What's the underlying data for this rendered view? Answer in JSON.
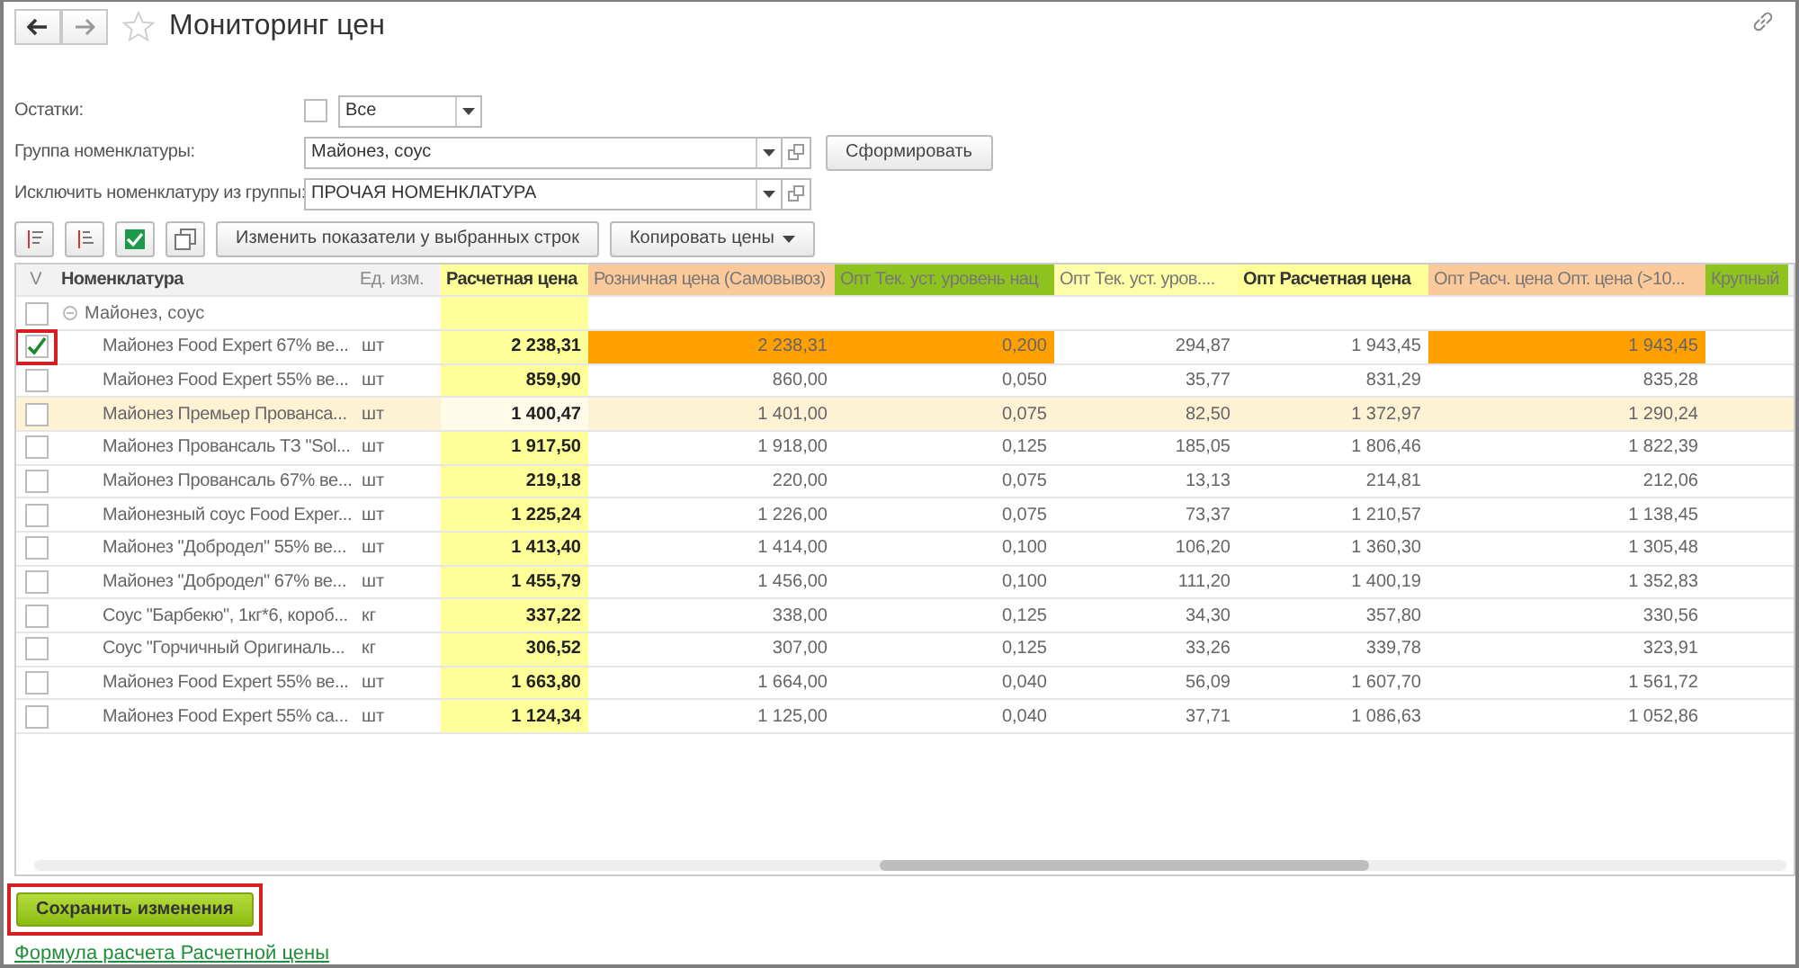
{
  "window": {
    "title": "Мониторинг цен"
  },
  "filters": [
    {
      "label": "Остатки:",
      "kind": "checkcombo",
      "checked": false,
      "value": "Все"
    },
    {
      "label": "Группа номенклатуры:",
      "kind": "select",
      "value": "Майонез, соус",
      "button": "Сформировать"
    },
    {
      "label": "Исключить номенклатуру из группы:",
      "kind": "select",
      "value": "ПРОЧАЯ НОМЕНКЛАТУРА"
    }
  ],
  "toolbar": {
    "buttons": [
      "Изменить показатели у выбранных строк"
    ],
    "menu": "Копировать цены"
  },
  "table": {
    "check_header": "V",
    "name_header": "Номенклатура",
    "unit_header": "Ед. изм.",
    "columns": [
      {
        "title": "Расчетная цена",
        "color": "#ffff99",
        "bold": true
      },
      {
        "title": "Розничная цена (Самовывоз)",
        "color": "#fcc99b",
        "bold": false
      },
      {
        "title": "Опт Тек. уст. уровень нац",
        "color": "#8dc21f",
        "bold": false
      },
      {
        "title": "Опт Тек. уст. уров....",
        "color": "#ffffaa",
        "bold": false
      },
      {
        "title": "Опт Расчетная цена",
        "color": "#ffff99",
        "bold": true
      },
      {
        "title": "Опт Расч. цена Опт. цена (>10...",
        "color": "#fcc99b",
        "bold": false
      },
      {
        "title": "Крупный",
        "color": "#8dc21f",
        "bold": false
      }
    ],
    "group": {
      "name": "Майонез, соус",
      "checked": false,
      "expanded": true
    },
    "rows": [
      {
        "name": "Майонез Food Expert 67% ве...",
        "unit": "шт",
        "cells": [
          {
            "text": "2 238,31",
            "alert": false
          },
          {
            "text": "2 238,31",
            "alert": true
          },
          {
            "text": "0,200",
            "alert": true
          },
          {
            "text": "294,87",
            "alert": false
          },
          {
            "text": "1 943,45",
            "alert": false
          },
          {
            "text": "1 943,45",
            "alert": true
          }
        ],
        "checked": true,
        "annotated": true,
        "selected": false
      },
      {
        "name": "Майонез Food Expert 55% ве...",
        "unit": "шт",
        "cells": [
          {
            "text": "859,90",
            "alert": false
          },
          {
            "text": "860,00",
            "alert": false
          },
          {
            "text": "0,050",
            "alert": false
          },
          {
            "text": "35,77",
            "alert": false
          },
          {
            "text": "831,29",
            "alert": false
          },
          {
            "text": "835,28",
            "alert": false
          }
        ],
        "checked": false,
        "annotated": false,
        "selected": false
      },
      {
        "name": "Майонез Премьер  Прованса...",
        "unit": "шт",
        "cells": [
          {
            "text": "1 400,47",
            "alert": false
          },
          {
            "text": "1 401,00",
            "alert": false
          },
          {
            "text": "0,075",
            "alert": false
          },
          {
            "text": "82,50",
            "alert": false
          },
          {
            "text": "1 372,97",
            "alert": false
          },
          {
            "text": "1 290,24",
            "alert": false
          }
        ],
        "checked": false,
        "annotated": false,
        "selected": true
      },
      {
        "name": "Майонез Провансаль ТЗ \"Sol...",
        "unit": "шт",
        "cells": [
          {
            "text": "1 917,50",
            "alert": false
          },
          {
            "text": "1 918,00",
            "alert": false
          },
          {
            "text": "0,125",
            "alert": false
          },
          {
            "text": "185,05",
            "alert": false
          },
          {
            "text": "1 806,46",
            "alert": false
          },
          {
            "text": "1 822,39",
            "alert": false
          }
        ],
        "checked": false,
        "annotated": false,
        "selected": false
      },
      {
        "name": "Майонез Провансаль 67% ве...",
        "unit": "шт",
        "cells": [
          {
            "text": "219,18",
            "alert": false
          },
          {
            "text": "220,00",
            "alert": false
          },
          {
            "text": "0,075",
            "alert": false
          },
          {
            "text": "13,13",
            "alert": false
          },
          {
            "text": "214,81",
            "alert": false
          },
          {
            "text": "212,06",
            "alert": false
          }
        ],
        "checked": false,
        "annotated": false,
        "selected": false
      },
      {
        "name": "Майонезный соус Food Exper...",
        "unit": "шт",
        "cells": [
          {
            "text": "1 225,24",
            "alert": false
          },
          {
            "text": "1 226,00",
            "alert": false
          },
          {
            "text": "0,075",
            "alert": false
          },
          {
            "text": "73,37",
            "alert": false
          },
          {
            "text": "1 210,57",
            "alert": false
          },
          {
            "text": "1 138,45",
            "alert": false
          }
        ],
        "checked": false,
        "annotated": false,
        "selected": false
      },
      {
        "name": "Майонез \"Добродел\" 55% ве...",
        "unit": "шт",
        "cells": [
          {
            "text": "1 413,40",
            "alert": false
          },
          {
            "text": "1 414,00",
            "alert": false
          },
          {
            "text": "0,100",
            "alert": false
          },
          {
            "text": "106,20",
            "alert": false
          },
          {
            "text": "1 360,30",
            "alert": false
          },
          {
            "text": "1 305,48",
            "alert": false
          }
        ],
        "checked": false,
        "annotated": false,
        "selected": false
      },
      {
        "name": "Майонез \"Добродел\" 67% ве...",
        "unit": "шт",
        "cells": [
          {
            "text": "1 455,79",
            "alert": false
          },
          {
            "text": "1 456,00",
            "alert": false
          },
          {
            "text": "0,100",
            "alert": false
          },
          {
            "text": "111,20",
            "alert": false
          },
          {
            "text": "1 400,19",
            "alert": false
          },
          {
            "text": "1 352,83",
            "alert": false
          }
        ],
        "checked": false,
        "annotated": false,
        "selected": false
      },
      {
        "name": "Соус \"Барбекю\", 1кг*6, короб...",
        "unit": "кг",
        "cells": [
          {
            "text": "337,22",
            "alert": false
          },
          {
            "text": "338,00",
            "alert": false
          },
          {
            "text": "0,125",
            "alert": false
          },
          {
            "text": "34,30",
            "alert": false
          },
          {
            "text": "357,80",
            "alert": false
          },
          {
            "text": "330,56",
            "alert": false
          }
        ],
        "checked": false,
        "annotated": false,
        "selected": false
      },
      {
        "name": "Соус \"Горчичный Оригиналь...",
        "unit": "кг",
        "cells": [
          {
            "text": "306,52",
            "alert": false
          },
          {
            "text": "307,00",
            "alert": false
          },
          {
            "text": "0,125",
            "alert": false
          },
          {
            "text": "33,26",
            "alert": false
          },
          {
            "text": "339,78",
            "alert": false
          },
          {
            "text": "323,91",
            "alert": false
          }
        ],
        "checked": false,
        "annotated": false,
        "selected": false
      },
      {
        "name": "Майонез Food Expert 55% ве...",
        "unit": "шт",
        "cells": [
          {
            "text": "1 663,80",
            "alert": false
          },
          {
            "text": "1 664,00",
            "alert": false
          },
          {
            "text": "0,040",
            "alert": false
          },
          {
            "text": "56,09",
            "alert": false
          },
          {
            "text": "1 607,70",
            "alert": false
          },
          {
            "text": "1 561,72",
            "alert": false
          }
        ],
        "checked": false,
        "annotated": false,
        "selected": false
      },
      {
        "name": "Майонез Food Expert 55% са...",
        "unit": "шт",
        "cells": [
          {
            "text": "1 124,34",
            "alert": false
          },
          {
            "text": "1 125,00",
            "alert": false
          },
          {
            "text": "0,040",
            "alert": false
          },
          {
            "text": "37,71",
            "alert": false
          },
          {
            "text": "1 086,63",
            "alert": false
          },
          {
            "text": "1 052,86",
            "alert": false
          }
        ],
        "checked": false,
        "annotated": false,
        "selected": false
      }
    ]
  },
  "save_button": {
    "label": "Сохранить изменения",
    "annotated": true
  },
  "formula_link": "Формула расчета Расчетной цены"
}
